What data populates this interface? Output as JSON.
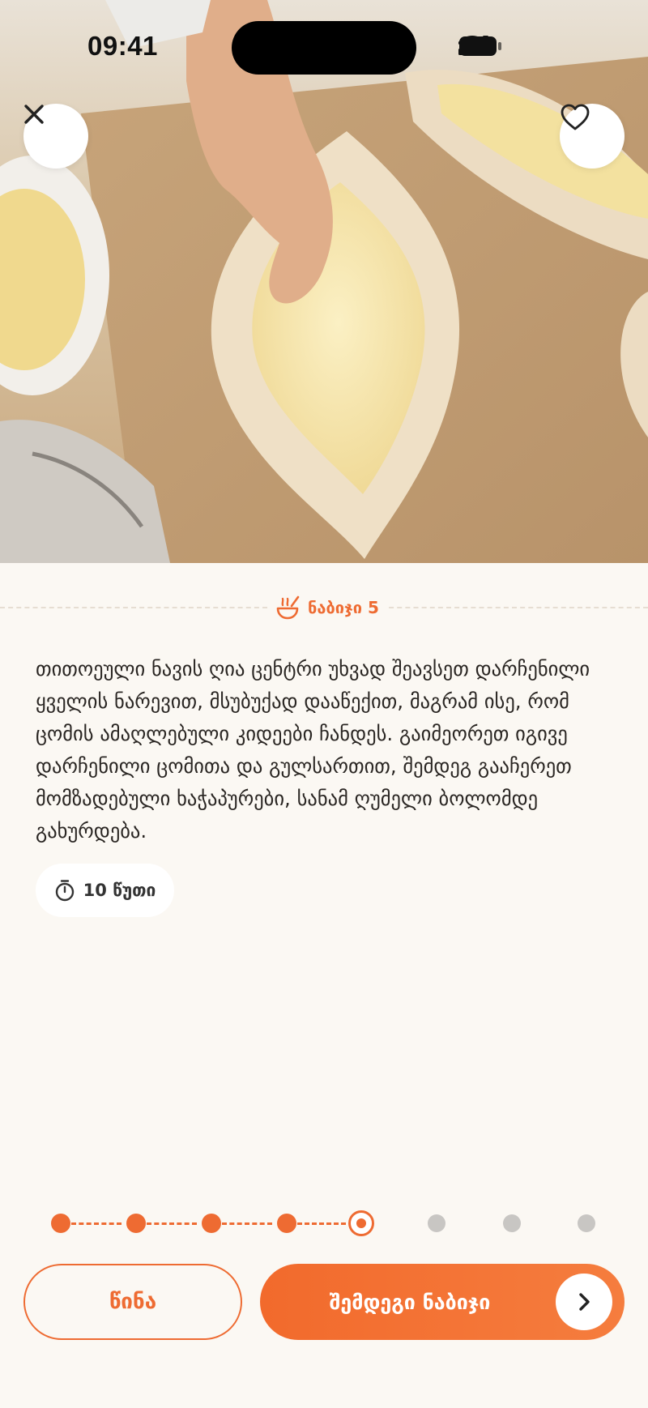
{
  "status_bar": {
    "time": "09:41"
  },
  "header": {
    "close_icon": "close-icon",
    "favorite_icon": "heart-icon"
  },
  "step": {
    "label": "ნაბიჯი 5",
    "icon": "cooking-pot-icon",
    "instructions": "თითოეული ნავის ღია ცენტრი უხვად შეავსეთ დარჩენილი ყველის ნარევით, მსუბუქად დააწექით, მაგრამ ისე, რომ ცომის ამაღლებული კიდეები ჩანდეს. გაიმეორეთ იგივე დარჩენილი ცომითა და გულსართით, შემდეგ გააჩერეთ მომზადებული ხაჭაპურები, სანამ ღუმელი ბოლომდე გახურდება.",
    "timer": "10 წუთი",
    "timer_icon": "stopwatch-icon"
  },
  "progress": {
    "total_steps": 8,
    "current_step": 5
  },
  "buttons": {
    "prev_label": "წინა",
    "next_label": "შემდეგი ნაბიჯი",
    "next_icon": "chevron-right-icon"
  },
  "colors": {
    "accent": "#ee6b32",
    "background": "#fbf8f3",
    "inactive_dot": "#c8c6c3"
  }
}
